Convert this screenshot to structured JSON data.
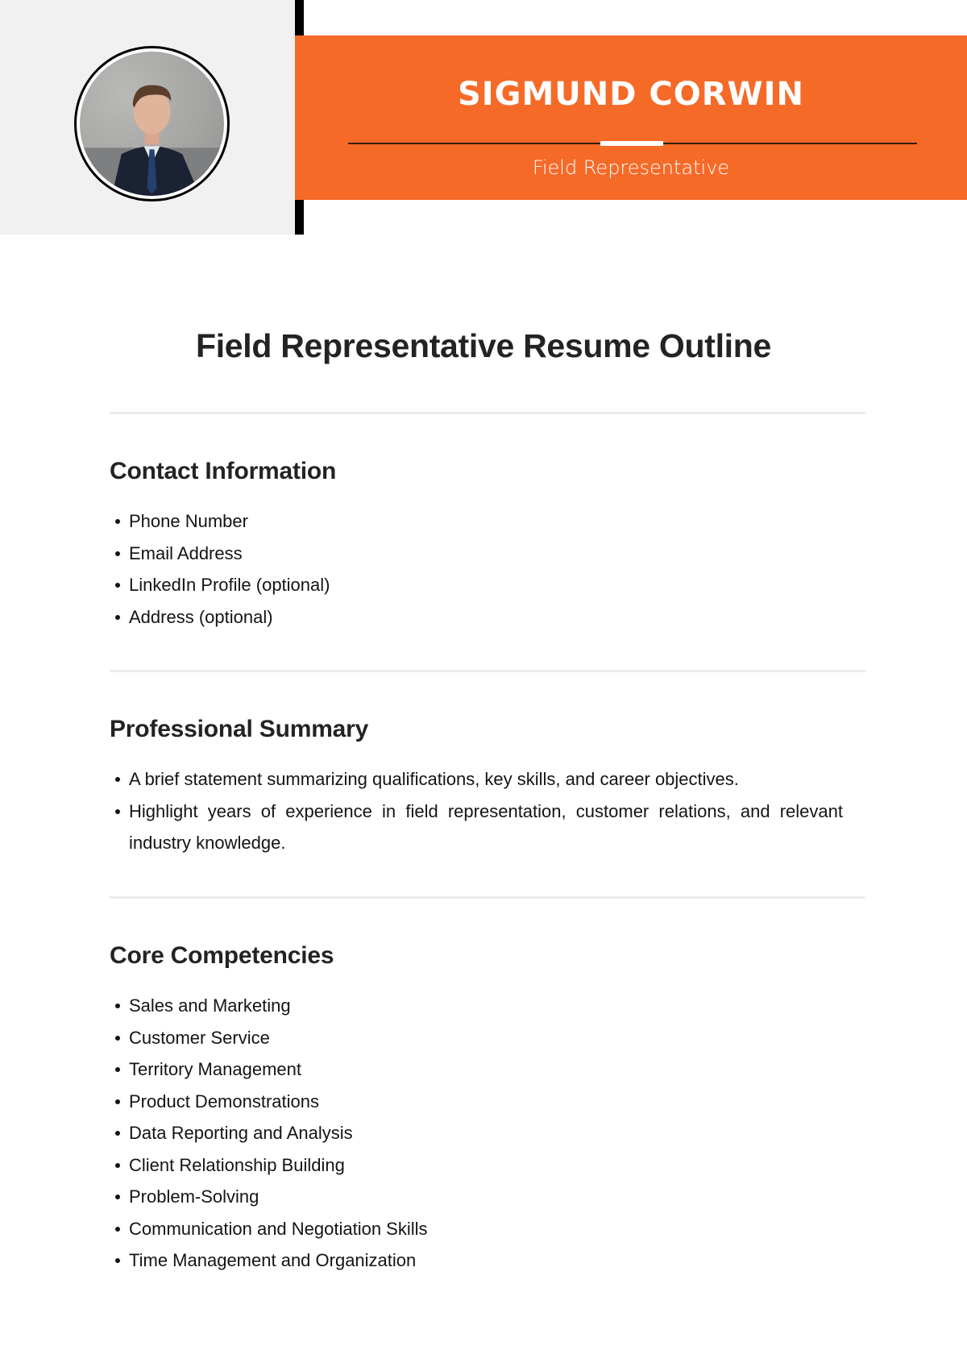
{
  "header": {
    "name": "SIGMUND CORWIN",
    "job_title": "Field Representative",
    "accent_color": "#f66a28",
    "photo_alt": "Portrait of Sigmund Corwin in a navy suit and blue tie"
  },
  "document": {
    "title": "Field Representative Resume Outline"
  },
  "sections": [
    {
      "heading": "Contact Information",
      "items": [
        "Phone Number",
        "Email Address",
        "LinkedIn Profile (optional)",
        "Address (optional)"
      ]
    },
    {
      "heading": "Professional Summary",
      "items": [
        "A brief statement summarizing qualifications, key skills, and career objectives.",
        "Highlight years of experience in field representation, customer relations, and relevant industry knowledge."
      ]
    },
    {
      "heading": "Core Competencies",
      "items": [
        "Sales and Marketing",
        "Customer Service",
        "Territory Management",
        "Product Demonstrations",
        "Data Reporting and Analysis",
        "Client Relationship Building",
        "Problem-Solving",
        "Communication and Negotiation Skills",
        "Time Management and Organization"
      ]
    }
  ]
}
